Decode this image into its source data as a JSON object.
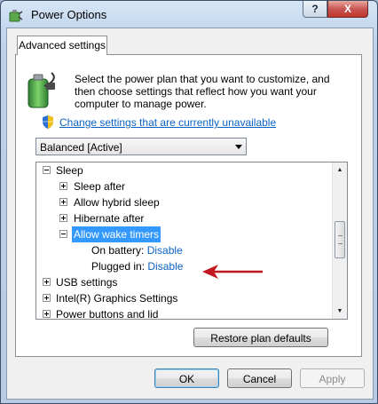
{
  "window": {
    "title": "Power Options",
    "help_label": "?",
    "close_label": "X"
  },
  "tab": {
    "label": "Advanced settings"
  },
  "description": "Select the power plan that you want to customize, and then choose settings that reflect how you want your computer to manage power.",
  "change_link": "Change settings that are currently unavailable",
  "plan_select": {
    "value": "Balanced [Active]"
  },
  "tree": {
    "sleep": "Sleep",
    "sleep_after": "Sleep after",
    "allow_hybrid_sleep": "Allow hybrid sleep",
    "hibernate_after": "Hibernate after",
    "allow_wake_timers": "Allow wake timers",
    "on_battery_label": "On battery:",
    "on_battery_value": "Disable",
    "plugged_in_label": "Plugged in:",
    "plugged_in_value": "Disable",
    "usb_settings": "USB settings",
    "intel_graphics": "Intel(R) Graphics Settings",
    "power_buttons": "Power buttons and lid"
  },
  "buttons": {
    "restore": "Restore plan defaults",
    "ok": "OK",
    "cancel": "Cancel",
    "apply": "Apply"
  },
  "colors": {
    "link": "#0b62c4",
    "selection": "#3399ff",
    "annotation_arrow": "#c0181e"
  },
  "icons": [
    "power-options-icon",
    "battery-plug-icon",
    "uac-shield-icon",
    "red-arrow-icon",
    "chevron-up-icon",
    "chevron-down-icon"
  ]
}
